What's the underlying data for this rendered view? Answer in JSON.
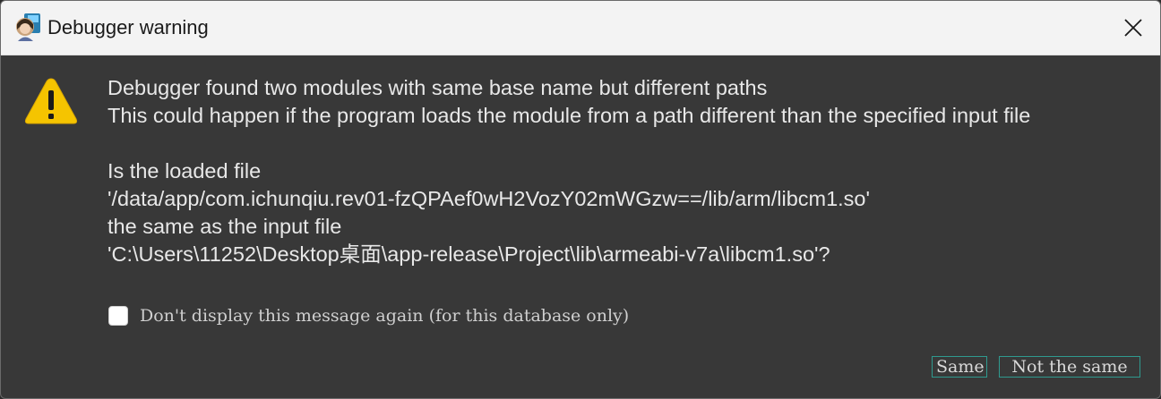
{
  "window": {
    "title": "Debugger warning"
  },
  "message": {
    "lines": [
      "Debugger found two modules with same base name but different paths",
      "This could happen if the program loads the module from a path different than the specified input file",
      "",
      "Is the loaded file",
      "'/data/app/com.ichunqiu.rev01-fzQPAef0wH2VozY02mWGzw==/lib/arm/libcm1.so'",
      "the same as the input file",
      "'C:\\Users\\11252\\Desktop桌面\\app-release\\Project\\lib\\armeabi-v7a\\libcm1.so'?"
    ]
  },
  "checkbox": {
    "label": "Don't display this message again (for this database only)",
    "checked": false
  },
  "buttons": {
    "same": "Same",
    "not_same": "Not the same"
  },
  "icons": {
    "app": "app-icon",
    "warning": "warning-icon",
    "close": "close-icon"
  },
  "colors": {
    "dialog_bg": "#383838",
    "titlebar_bg": "#f3f3f3",
    "warning_yellow": "#f5c400",
    "button_border": "#2f9a8f"
  }
}
